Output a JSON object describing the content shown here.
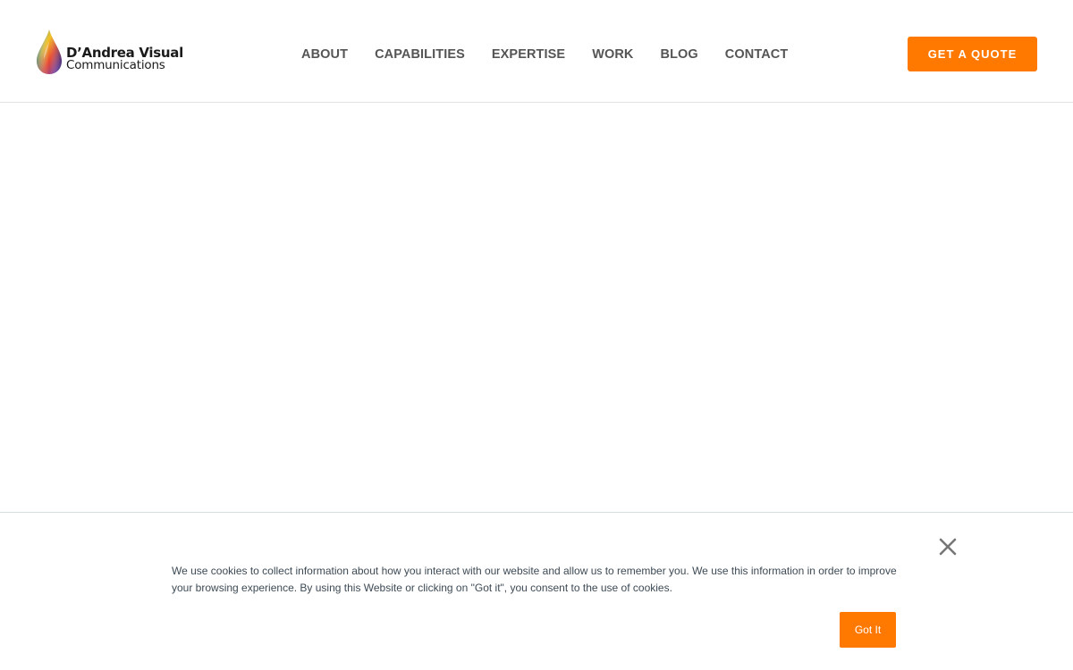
{
  "header": {
    "logo": {
      "line1": "D’Andrea Visual",
      "line2": "Communications",
      "icon": "color-drop-icon"
    },
    "nav": [
      {
        "label": "ABOUT"
      },
      {
        "label": "CAPABILITIES"
      },
      {
        "label": "EXPERTISE"
      },
      {
        "label": "WORK"
      },
      {
        "label": "BLOG"
      },
      {
        "label": "CONTACT"
      }
    ],
    "cta_label": "GET A QUOTE"
  },
  "cookie_banner": {
    "text": "We use cookies to collect information about how you interact with our website and allow us to remember you. We use this information in order to improve your browsing experience. By using this Website or clicking on \"Got it\", you consent to the use of cookies.",
    "button_label": "Got It",
    "close_icon": "close-icon"
  },
  "colors": {
    "accent": "#ff7800",
    "nav_text": "#555555",
    "body_text": "#3d4a55"
  }
}
